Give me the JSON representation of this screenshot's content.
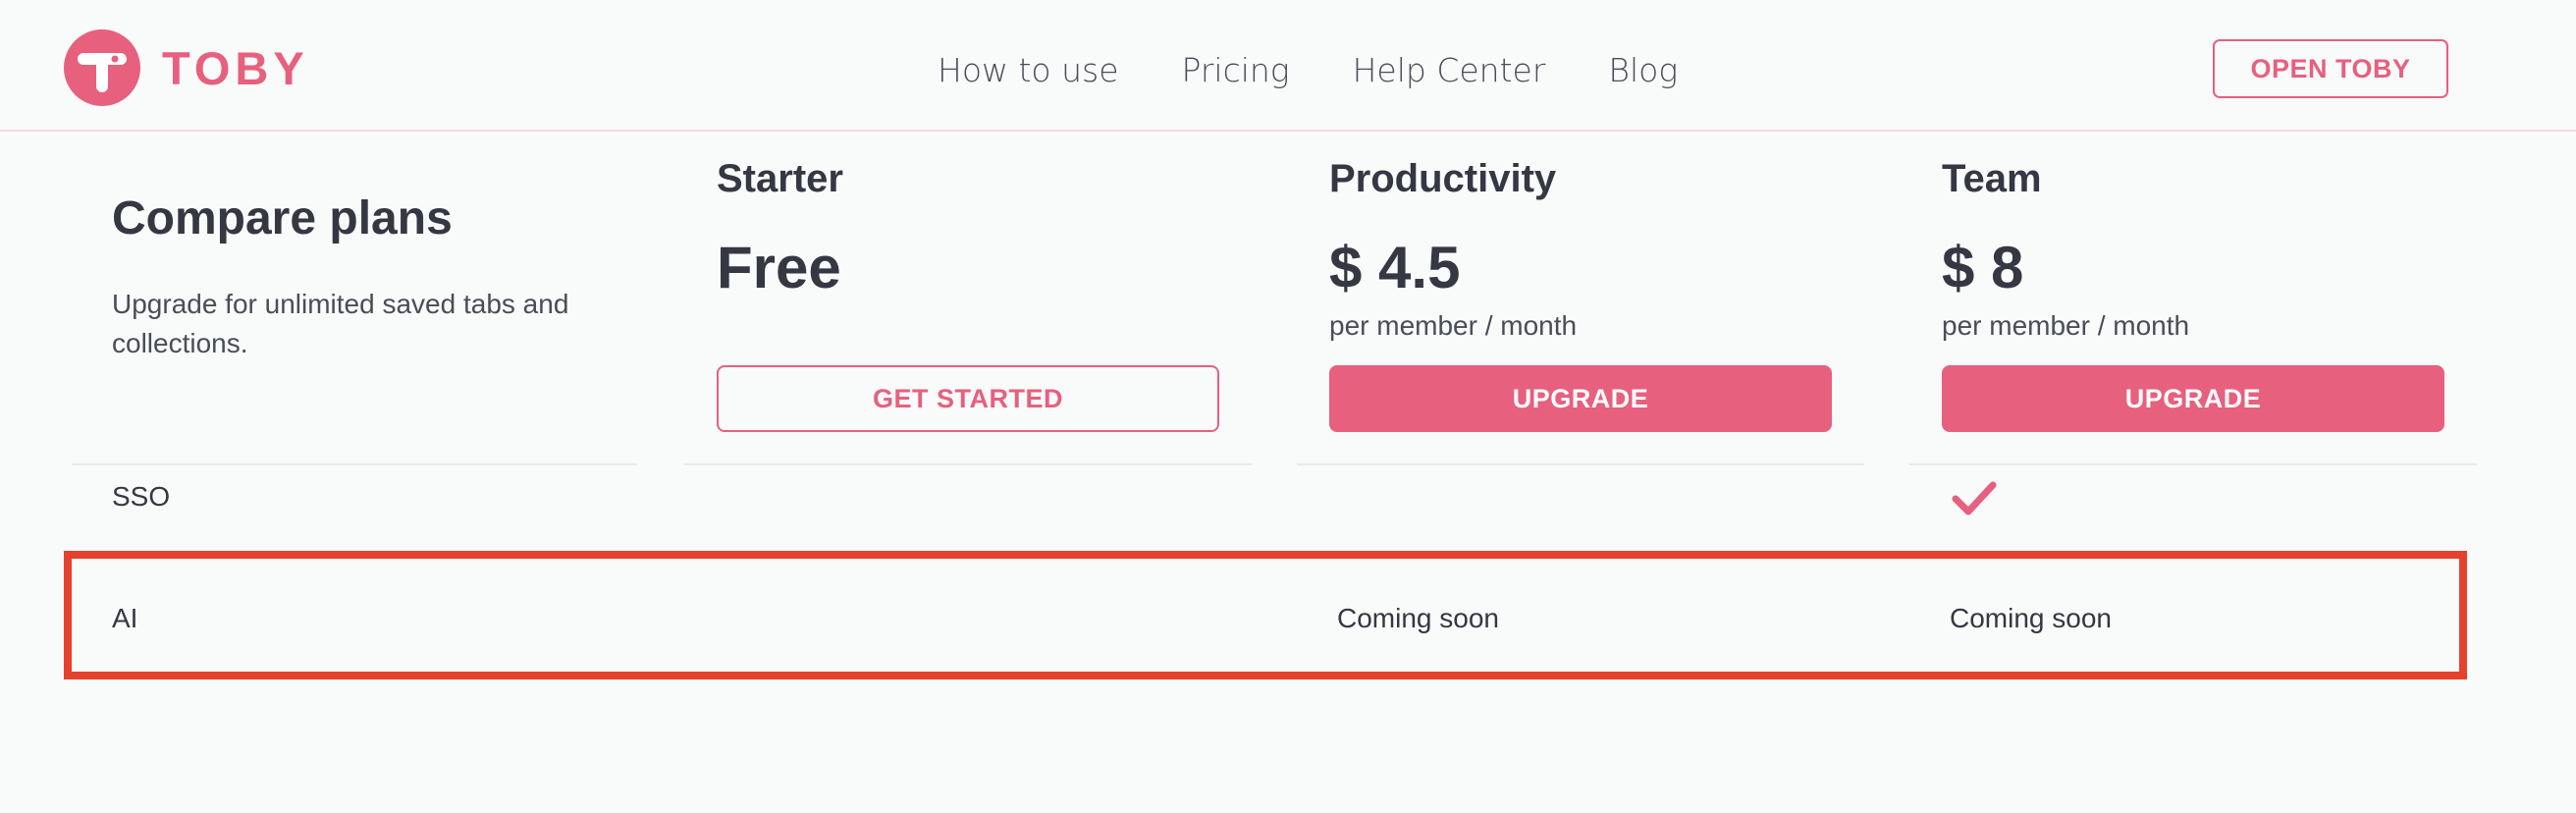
{
  "brand": {
    "name": "TOBY",
    "color": "#e7607d",
    "logo_icon": "toby-logo-icon"
  },
  "nav": {
    "items": [
      "How to use",
      "Pricing",
      "Help Center",
      "Blog"
    ]
  },
  "header": {
    "open_button": "OPEN TOBY"
  },
  "compare": {
    "title": "Compare plans",
    "subtitle": "Upgrade for unlimited saved tabs and collections."
  },
  "plans": [
    {
      "name": "Starter",
      "price": "Free",
      "period": "",
      "button": "GET STARTED"
    },
    {
      "name": "Productivity",
      "price": "$ 4.5",
      "period": "per member / month",
      "button": "UPGRADE"
    },
    {
      "name": "Team",
      "price": "$ 8",
      "period": "per member / month",
      "button": "UPGRADE"
    }
  ],
  "features": [
    {
      "label": "SSO",
      "starter": "",
      "productivity": "",
      "team": "check-icon"
    },
    {
      "label": "AI",
      "starter": "",
      "productivity": "Coming soon",
      "team": "Coming soon"
    }
  ],
  "colors": {
    "accent": "#e7607d",
    "highlight": "#e5412d",
    "text": "#353743"
  }
}
